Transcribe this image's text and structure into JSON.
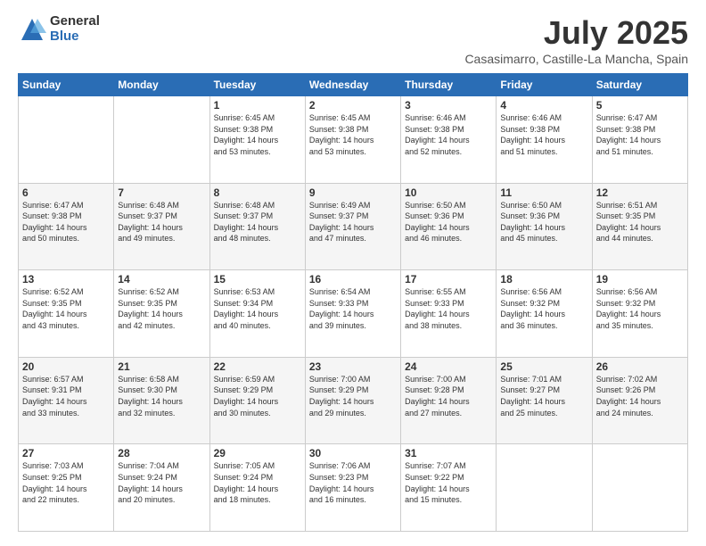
{
  "logo": {
    "general": "General",
    "blue": "Blue"
  },
  "header": {
    "title": "July 2025",
    "subtitle": "Casasimarro, Castille-La Mancha, Spain"
  },
  "days_of_week": [
    "Sunday",
    "Monday",
    "Tuesday",
    "Wednesday",
    "Thursday",
    "Friday",
    "Saturday"
  ],
  "weeks": [
    [
      {
        "day": "",
        "info": ""
      },
      {
        "day": "",
        "info": ""
      },
      {
        "day": "1",
        "info": "Sunrise: 6:45 AM\nSunset: 9:38 PM\nDaylight: 14 hours\nand 53 minutes."
      },
      {
        "day": "2",
        "info": "Sunrise: 6:45 AM\nSunset: 9:38 PM\nDaylight: 14 hours\nand 53 minutes."
      },
      {
        "day": "3",
        "info": "Sunrise: 6:46 AM\nSunset: 9:38 PM\nDaylight: 14 hours\nand 52 minutes."
      },
      {
        "day": "4",
        "info": "Sunrise: 6:46 AM\nSunset: 9:38 PM\nDaylight: 14 hours\nand 51 minutes."
      },
      {
        "day": "5",
        "info": "Sunrise: 6:47 AM\nSunset: 9:38 PM\nDaylight: 14 hours\nand 51 minutes."
      }
    ],
    [
      {
        "day": "6",
        "info": "Sunrise: 6:47 AM\nSunset: 9:38 PM\nDaylight: 14 hours\nand 50 minutes."
      },
      {
        "day": "7",
        "info": "Sunrise: 6:48 AM\nSunset: 9:37 PM\nDaylight: 14 hours\nand 49 minutes."
      },
      {
        "day": "8",
        "info": "Sunrise: 6:48 AM\nSunset: 9:37 PM\nDaylight: 14 hours\nand 48 minutes."
      },
      {
        "day": "9",
        "info": "Sunrise: 6:49 AM\nSunset: 9:37 PM\nDaylight: 14 hours\nand 47 minutes."
      },
      {
        "day": "10",
        "info": "Sunrise: 6:50 AM\nSunset: 9:36 PM\nDaylight: 14 hours\nand 46 minutes."
      },
      {
        "day": "11",
        "info": "Sunrise: 6:50 AM\nSunset: 9:36 PM\nDaylight: 14 hours\nand 45 minutes."
      },
      {
        "day": "12",
        "info": "Sunrise: 6:51 AM\nSunset: 9:35 PM\nDaylight: 14 hours\nand 44 minutes."
      }
    ],
    [
      {
        "day": "13",
        "info": "Sunrise: 6:52 AM\nSunset: 9:35 PM\nDaylight: 14 hours\nand 43 minutes."
      },
      {
        "day": "14",
        "info": "Sunrise: 6:52 AM\nSunset: 9:35 PM\nDaylight: 14 hours\nand 42 minutes."
      },
      {
        "day": "15",
        "info": "Sunrise: 6:53 AM\nSunset: 9:34 PM\nDaylight: 14 hours\nand 40 minutes."
      },
      {
        "day": "16",
        "info": "Sunrise: 6:54 AM\nSunset: 9:33 PM\nDaylight: 14 hours\nand 39 minutes."
      },
      {
        "day": "17",
        "info": "Sunrise: 6:55 AM\nSunset: 9:33 PM\nDaylight: 14 hours\nand 38 minutes."
      },
      {
        "day": "18",
        "info": "Sunrise: 6:56 AM\nSunset: 9:32 PM\nDaylight: 14 hours\nand 36 minutes."
      },
      {
        "day": "19",
        "info": "Sunrise: 6:56 AM\nSunset: 9:32 PM\nDaylight: 14 hours\nand 35 minutes."
      }
    ],
    [
      {
        "day": "20",
        "info": "Sunrise: 6:57 AM\nSunset: 9:31 PM\nDaylight: 14 hours\nand 33 minutes."
      },
      {
        "day": "21",
        "info": "Sunrise: 6:58 AM\nSunset: 9:30 PM\nDaylight: 14 hours\nand 32 minutes."
      },
      {
        "day": "22",
        "info": "Sunrise: 6:59 AM\nSunset: 9:29 PM\nDaylight: 14 hours\nand 30 minutes."
      },
      {
        "day": "23",
        "info": "Sunrise: 7:00 AM\nSunset: 9:29 PM\nDaylight: 14 hours\nand 29 minutes."
      },
      {
        "day": "24",
        "info": "Sunrise: 7:00 AM\nSunset: 9:28 PM\nDaylight: 14 hours\nand 27 minutes."
      },
      {
        "day": "25",
        "info": "Sunrise: 7:01 AM\nSunset: 9:27 PM\nDaylight: 14 hours\nand 25 minutes."
      },
      {
        "day": "26",
        "info": "Sunrise: 7:02 AM\nSunset: 9:26 PM\nDaylight: 14 hours\nand 24 minutes."
      }
    ],
    [
      {
        "day": "27",
        "info": "Sunrise: 7:03 AM\nSunset: 9:25 PM\nDaylight: 14 hours\nand 22 minutes."
      },
      {
        "day": "28",
        "info": "Sunrise: 7:04 AM\nSunset: 9:24 PM\nDaylight: 14 hours\nand 20 minutes."
      },
      {
        "day": "29",
        "info": "Sunrise: 7:05 AM\nSunset: 9:24 PM\nDaylight: 14 hours\nand 18 minutes."
      },
      {
        "day": "30",
        "info": "Sunrise: 7:06 AM\nSunset: 9:23 PM\nDaylight: 14 hours\nand 16 minutes."
      },
      {
        "day": "31",
        "info": "Sunrise: 7:07 AM\nSunset: 9:22 PM\nDaylight: 14 hours\nand 15 minutes."
      },
      {
        "day": "",
        "info": ""
      },
      {
        "day": "",
        "info": ""
      }
    ]
  ]
}
